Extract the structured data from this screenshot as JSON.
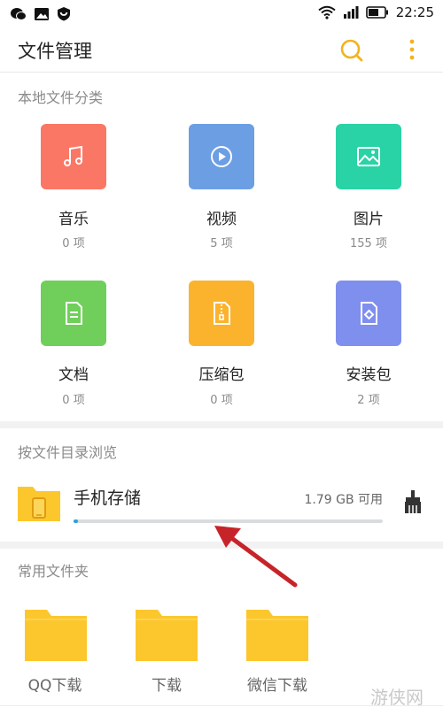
{
  "status": {
    "time": "22:25"
  },
  "app": {
    "title": "文件管理"
  },
  "local": {
    "title": "本地文件分类",
    "items": [
      {
        "name": "音乐",
        "count": "0 项",
        "color": "#fb7765",
        "icon": "music-note-icon"
      },
      {
        "name": "视频",
        "count": "5 项",
        "color": "#6c9ee4",
        "icon": "play-circle-icon"
      },
      {
        "name": "图片",
        "count": "155 项",
        "color": "#29d3a5",
        "icon": "image-icon"
      },
      {
        "name": "文档",
        "count": "0 项",
        "color": "#6fcf5a",
        "icon": "document-icon"
      },
      {
        "name": "压缩包",
        "count": "0 项",
        "color": "#fbb32e",
        "icon": "zip-icon"
      },
      {
        "name": "安装包",
        "count": "2 项",
        "color": "#7f8fee",
        "icon": "package-icon"
      }
    ]
  },
  "directory": {
    "title": "按文件目录浏览",
    "storage": {
      "name": "手机存储",
      "free": "1.79 GB 可用",
      "used_fraction": 0.015
    }
  },
  "common": {
    "title": "常用文件夹",
    "folders": [
      {
        "name": "QQ下载"
      },
      {
        "name": "下载"
      },
      {
        "name": "微信下载"
      }
    ]
  },
  "watermark": "游侠网",
  "colors": {
    "accent": "#f2b320",
    "folder": "#fcc72d",
    "arrow": "#c7242a"
  }
}
